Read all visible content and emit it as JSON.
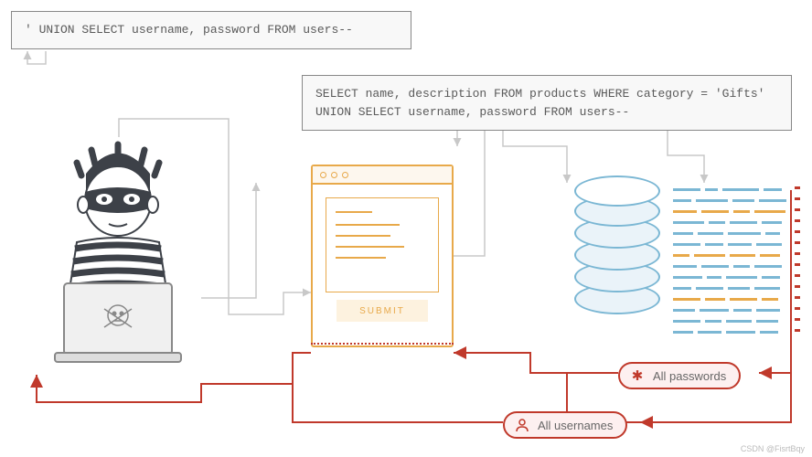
{
  "injection_payload": "' UNION SELECT username, password FROM users--",
  "resulting_query": "SELECT name, description FROM products WHERE category = 'Gifts' UNION SELECT username, password FROM users--",
  "submit_label": "SUBMIT",
  "pill_passwords": "All passwords",
  "pill_usernames": "All usernames",
  "watermark": "CSDN @FisrtBqy",
  "colors": {
    "code_text": "#5a5a5a",
    "browser_accent": "#e8a94a",
    "db_accent": "#7bb7d4",
    "danger": "#c0392b"
  }
}
